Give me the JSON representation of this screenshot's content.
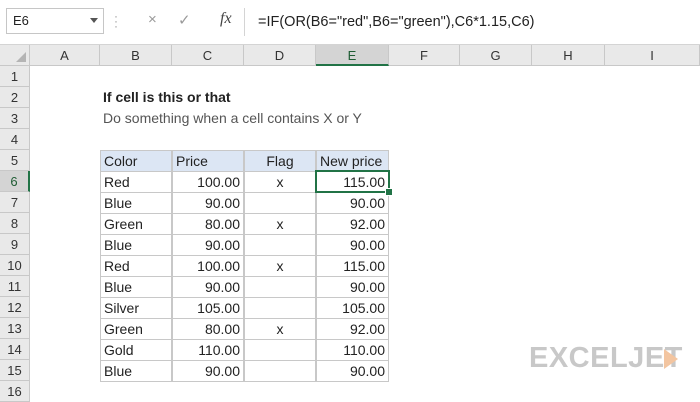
{
  "formula_bar": {
    "name_box": "E6",
    "cancel_icon": "×",
    "enter_icon": "✓",
    "fx_label": "fx",
    "formula": "=IF(OR(B6=\"red\",B6=\"green\"),C6*1.15,C6)"
  },
  "columns": [
    "A",
    "B",
    "C",
    "D",
    "E",
    "F",
    "G",
    "H",
    "I"
  ],
  "active_column": "E",
  "rows": [
    "1",
    "2",
    "3",
    "4",
    "5",
    "6",
    "7",
    "8",
    "9",
    "10",
    "11",
    "12",
    "13",
    "14",
    "15",
    "16"
  ],
  "active_row": "6",
  "sheet": {
    "title": "If cell is this or that",
    "subtitle": "Do something when a cell contains X or Y",
    "headers": {
      "color": "Color",
      "price": "Price",
      "flag": "Flag",
      "new_price": "New price"
    },
    "table": [
      {
        "color": "Red",
        "price": "100.00",
        "flag": "x",
        "new_price": "115.00"
      },
      {
        "color": "Blue",
        "price": "90.00",
        "flag": "",
        "new_price": "90.00"
      },
      {
        "color": "Green",
        "price": "80.00",
        "flag": "x",
        "new_price": "92.00"
      },
      {
        "color": "Blue",
        "price": "90.00",
        "flag": "",
        "new_price": "90.00"
      },
      {
        "color": "Red",
        "price": "100.00",
        "flag": "x",
        "new_price": "115.00"
      },
      {
        "color": "Blue",
        "price": "90.00",
        "flag": "",
        "new_price": "90.00"
      },
      {
        "color": "Silver",
        "price": "105.00",
        "flag": "",
        "new_price": "105.00"
      },
      {
        "color": "Green",
        "price": "80.00",
        "flag": "x",
        "new_price": "92.00"
      },
      {
        "color": "Gold",
        "price": "110.00",
        "flag": "",
        "new_price": "110.00"
      },
      {
        "color": "Blue",
        "price": "90.00",
        "flag": "",
        "new_price": "90.00"
      }
    ]
  },
  "watermark": {
    "text": "EXCELJET"
  },
  "colors": {
    "accent": "#217346",
    "header_fill": "#dce6f4",
    "grid": "#c8c8c8"
  }
}
